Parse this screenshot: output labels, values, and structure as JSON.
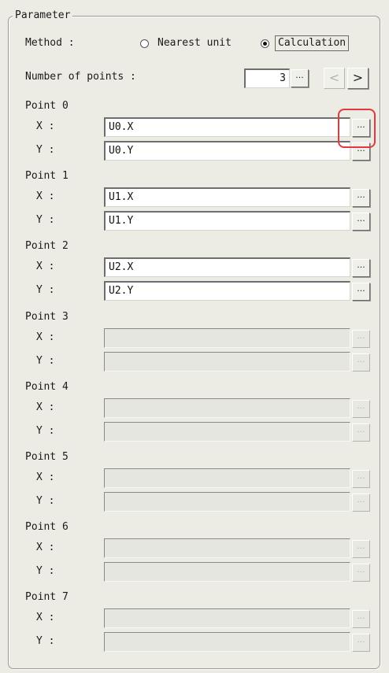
{
  "group": {
    "title": "Parameter"
  },
  "method": {
    "label": "Method :",
    "options": [
      {
        "label": "Nearest unit",
        "selected": false
      },
      {
        "label": "Calculation",
        "selected": true
      }
    ]
  },
  "number_of_points": {
    "label": "Number of points :",
    "value": "3",
    "ref_button": "...",
    "prev_icon": "chevron-left-icon",
    "next_icon": "chevron-right-icon",
    "prev_glyph": "<",
    "next_glyph": ">"
  },
  "points": [
    {
      "title": "Point 0",
      "x_label": "X :",
      "y_label": "Y :",
      "x_value": "U0.X",
      "y_value": "U0.Y",
      "enabled": true,
      "x_button": "...",
      "y_button": "..."
    },
    {
      "title": "Point 1",
      "x_label": "X :",
      "y_label": "Y :",
      "x_value": "U1.X",
      "y_value": "U1.Y",
      "enabled": true,
      "x_button": "...",
      "y_button": "..."
    },
    {
      "title": "Point 2",
      "x_label": "X :",
      "y_label": "Y :",
      "x_value": "U2.X",
      "y_value": "U2.Y",
      "enabled": true,
      "x_button": "...",
      "y_button": "..."
    },
    {
      "title": "Point 3",
      "x_label": "X :",
      "y_label": "Y :",
      "x_value": "",
      "y_value": "",
      "enabled": false,
      "x_button": "...",
      "y_button": "..."
    },
    {
      "title": "Point 4",
      "x_label": "X :",
      "y_label": "Y :",
      "x_value": "",
      "y_value": "",
      "enabled": false,
      "x_button": "...",
      "y_button": "..."
    },
    {
      "title": "Point 5",
      "x_label": "X :",
      "y_label": "Y :",
      "x_value": "",
      "y_value": "",
      "enabled": false,
      "x_button": "...",
      "y_button": "..."
    },
    {
      "title": "Point 6",
      "x_label": "X :",
      "y_label": "Y :",
      "x_value": "",
      "y_value": "",
      "enabled": false,
      "x_button": "...",
      "y_button": "..."
    },
    {
      "title": "Point 7",
      "x_label": "X :",
      "y_label": "Y :",
      "x_value": "",
      "y_value": "",
      "enabled": false,
      "x_button": "...",
      "y_button": "..."
    }
  ],
  "colors": {
    "panel_bg": "#ecece4",
    "highlight": "#e0393e"
  }
}
